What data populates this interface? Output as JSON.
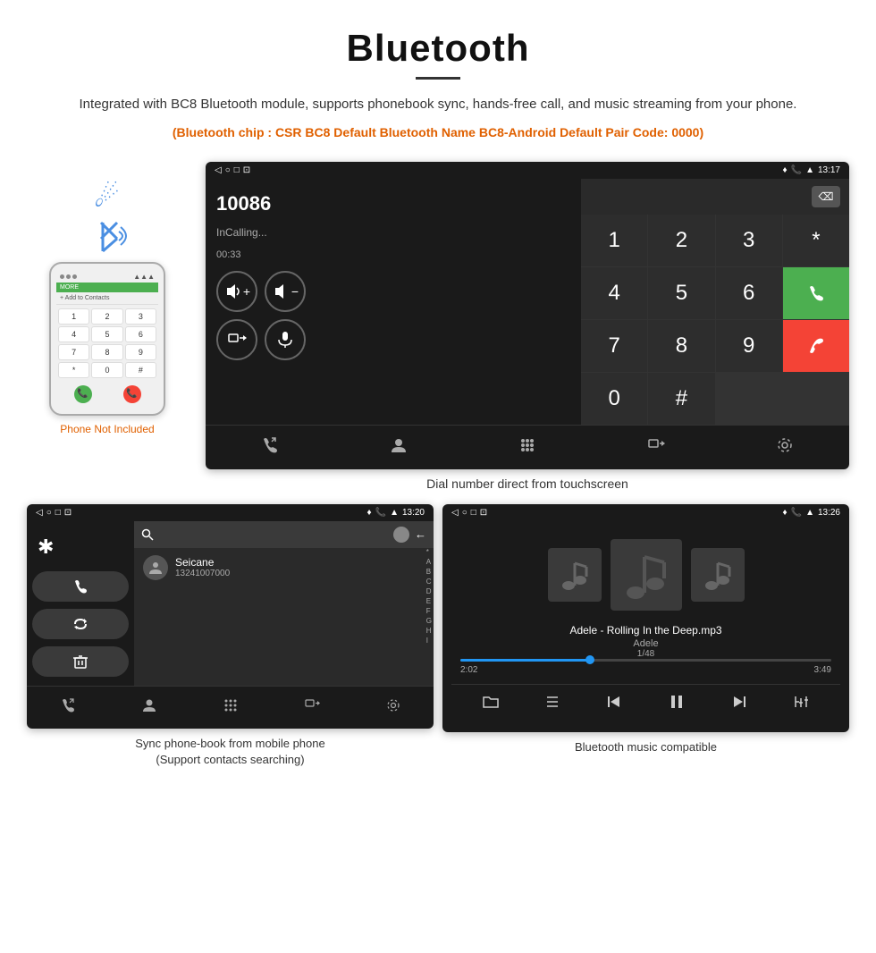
{
  "header": {
    "title": "Bluetooth",
    "description": "Integrated with BC8 Bluetooth module, supports phonebook sync, hands-free call, and music streaming from your phone.",
    "specs": "(Bluetooth chip : CSR BC8    Default Bluetooth Name BC8-Android    Default Pair Code: 0000)"
  },
  "phone": {
    "not_included": "Phone Not Included",
    "keys": [
      "1",
      "2",
      "3",
      "4",
      "5",
      "6",
      "7",
      "8",
      "9",
      "*",
      "0",
      "#"
    ]
  },
  "dial_screen": {
    "status_time": "13:17",
    "number": "10086",
    "call_status": "InCalling...",
    "call_duration": "00:33",
    "keypad": [
      "1",
      "2",
      "3",
      "*",
      "4",
      "5",
      "6",
      "0",
      "7",
      "8",
      "9",
      "#"
    ]
  },
  "dial_caption": "Dial number direct from touchscreen",
  "phonebook_screen": {
    "status_time": "13:20",
    "contact_name": "Seicane",
    "contact_number": "13241007000",
    "alphabet": [
      "A",
      "B",
      "C",
      "D",
      "E",
      "F",
      "G",
      "H",
      "I"
    ]
  },
  "phonebook_caption_line1": "Sync phone-book from mobile phone",
  "phonebook_caption_line2": "(Support contacts searching)",
  "music_screen": {
    "status_time": "13:26",
    "song": "Adele - Rolling In the Deep.mp3",
    "artist": "Adele",
    "track": "1/48",
    "time_current": "2:02",
    "time_total": "3:49"
  },
  "music_caption": "Bluetooth music compatible"
}
